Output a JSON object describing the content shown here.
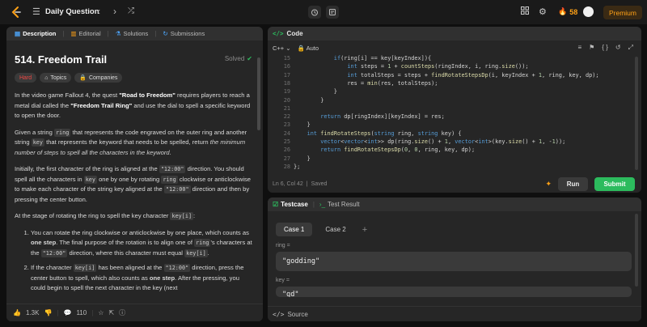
{
  "topbar": {
    "title": "Daily Question",
    "streak": "58",
    "premium_label": "Premium",
    "icons": [
      "logo-icon",
      "problem-list-icon",
      "chevron-left-icon",
      "chevron-right-icon",
      "shuffle-icon",
      "timer-icon",
      "notes-icon",
      "grid-icon",
      "gear-icon",
      "fire-icon",
      "avatar"
    ],
    "accent": "#ffa116"
  },
  "left_panel": {
    "tabs": [
      {
        "label": "Description",
        "active": true,
        "icon": "description-icon"
      },
      {
        "label": "Editorial",
        "icon": "editorial-icon"
      },
      {
        "label": "Solutions",
        "icon": "solutions-icon"
      },
      {
        "label": "Submissions",
        "icon": "submissions-icon"
      }
    ],
    "problem_title": "514. Freedom Trail",
    "solved_label": "Solved",
    "chips": {
      "difficulty": "Hard",
      "topics": "Topics",
      "companies": "Companies"
    },
    "difficulty_color": "#ef4743",
    "p1": {
      "a": "In the video game Fallout 4, the quest ",
      "b": "\"Road to Freedom\"",
      "c": " requires players to reach a metal dial called the ",
      "d": "\"Freedom Trail Ring\"",
      "e": " and use the dial to spell a specific keyword to open the door."
    },
    "p2": {
      "a": "Given a string ",
      "b": "ring",
      "c": " that represents the code engraved on the outer ring and another string ",
      "d": "key",
      "e": " that represents the keyword that needs to be spelled, return ",
      "f": "the minimum number of steps to spell all the characters in the keyword",
      "g": "."
    },
    "p3": {
      "a": "Initially, the first character of the ring is aligned at the ",
      "b": "\"12:00\"",
      "c": " direction. You should spell all the characters in ",
      "d": "key",
      "e": " one by one by rotating ",
      "f": "ring",
      "g": " clockwise or anticlockwise to make each character of the string key aligned at the ",
      "h": "\"12:00\"",
      "i": " direction and then by pressing the center button."
    },
    "p4": {
      "a": "At the stage of rotating the ring to spell the key character ",
      "b": "key[i]",
      "c": ":"
    },
    "li1": {
      "a": "You can rotate the ring clockwise or anticlockwise by one place, which counts as ",
      "b": "one step",
      "c": ". The final purpose of the rotation is to align one of ",
      "d": "ring",
      "e": "'s characters at the ",
      "f": "\"12:00\"",
      "g": " direction, where this character must equal ",
      "h": "key[i]",
      "i": "."
    },
    "li2": {
      "a": "If the character ",
      "b": "key[i]",
      "c": " has been aligned at the ",
      "d": "\"12:00\"",
      "e": " direction, press the center button to spell, which also counts as ",
      "f": "one step",
      "g": ". After the pressing, you could begin to spell the next character in the key (next"
    },
    "footer": {
      "likes": "1.3K",
      "comments": "110"
    }
  },
  "editor": {
    "title": "Code",
    "language": "C++",
    "mode": "Auto",
    "status": "Ln 6, Col 42",
    "saved": "Saved",
    "run_label": "Run",
    "submit_label": "Submit",
    "submit_color": "#2cbb5d",
    "lines": [
      {
        "n": "15",
        "code": "            if(ring[i] == key[keyIndex]){"
      },
      {
        "n": "16",
        "code": "                int steps = 1 + countSteps(ringIndex, i, ring.size());"
      },
      {
        "n": "17",
        "code": "                int totalSteps = steps + findRotateStepsDp(i, keyIndex + 1, ring, key, dp);"
      },
      {
        "n": "18",
        "code": "                res = min(res, totalSteps);"
      },
      {
        "n": "19",
        "code": "            }"
      },
      {
        "n": "20",
        "code": "        }"
      },
      {
        "n": "21",
        "code": ""
      },
      {
        "n": "22",
        "code": "        return dp[ringIndex][keyIndex] = res;"
      },
      {
        "n": "23",
        "code": "    }"
      },
      {
        "n": "24",
        "code": "    int findRotateSteps(string ring, string key) {"
      },
      {
        "n": "25",
        "code": "        vector<vector<int>> dp(ring.size() + 1, vector<int>(key.size() + 1, -1));"
      },
      {
        "n": "26",
        "code": "        return findRotateStepsDp(0, 0, ring, key, dp);"
      },
      {
        "n": "27",
        "code": "    }"
      },
      {
        "n": "28",
        "code": "};"
      }
    ]
  },
  "testcase": {
    "tab_testcase": "Testcase",
    "tab_result": "Test Result",
    "cases": [
      "Case 1",
      "Case 2"
    ],
    "ring_label": "ring =",
    "ring_value": "\"godding\"",
    "key_label": "key =",
    "key_value": "\"gd\"",
    "source_label": "Source"
  }
}
